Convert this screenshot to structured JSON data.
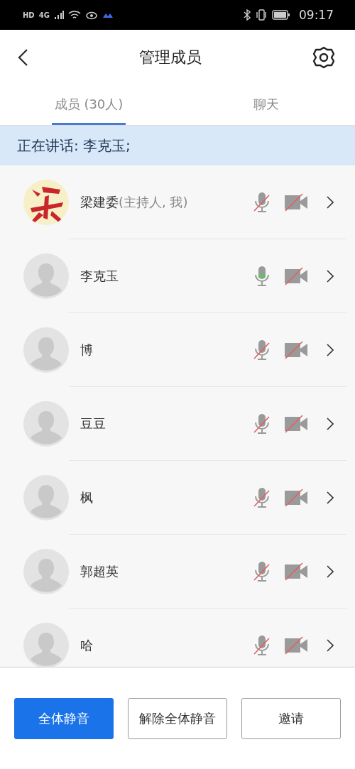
{
  "status_bar": {
    "badges": [
      "HD",
      "4G"
    ],
    "time": "09:17"
  },
  "header": {
    "title": "管理成员"
  },
  "tabs": [
    {
      "label": "成员 (30人)",
      "selected": true
    },
    {
      "label": "聊天",
      "selected": false
    }
  ],
  "speaking_banner": "正在讲话: 李克玉;",
  "members": [
    {
      "name": "梁建委",
      "role": "(主持人, 我)",
      "has_photo": true,
      "mic_muted": true,
      "speaking": false,
      "video_off": true
    },
    {
      "name": "李克玉",
      "has_photo": false,
      "mic_muted": false,
      "speaking": true,
      "video_off": true
    },
    {
      "name": "博",
      "has_photo": false,
      "mic_muted": true,
      "speaking": false,
      "video_off": true
    },
    {
      "name": "豆豆",
      "has_photo": false,
      "mic_muted": true,
      "speaking": false,
      "video_off": true
    },
    {
      "name": "枫",
      "has_photo": false,
      "mic_muted": true,
      "speaking": false,
      "video_off": true
    },
    {
      "name": "郭超英",
      "has_photo": false,
      "mic_muted": true,
      "speaking": false,
      "video_off": true
    },
    {
      "name": "哈",
      "has_photo": false,
      "mic_muted": true,
      "speaking": false,
      "video_off": true
    }
  ],
  "buttons": [
    {
      "label": "全体静音",
      "kind": "primary"
    },
    {
      "label": "解除全体静音",
      "kind": "outline"
    },
    {
      "label": "邀请",
      "kind": "outline"
    }
  ]
}
